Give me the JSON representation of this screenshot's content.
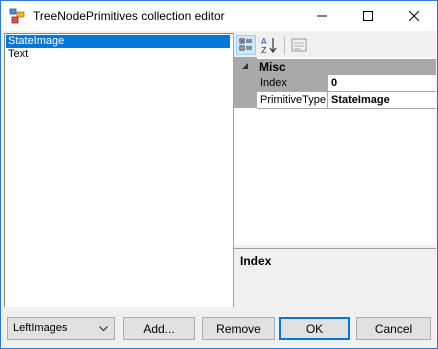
{
  "window": {
    "title": "TreeNodePrimitives collection editor"
  },
  "list": {
    "items": [
      {
        "label": "StateImage",
        "selected": true
      },
      {
        "label": "Text",
        "selected": false
      }
    ]
  },
  "toolbar": {
    "buttons": [
      "categorized-view",
      "alphabetical-sort",
      "property-pages"
    ]
  },
  "property_grid": {
    "category": "Misc",
    "rows": [
      {
        "name": "Index",
        "value": "0"
      },
      {
        "name": "PrimitiveType",
        "value": "StateImage"
      }
    ]
  },
  "help": {
    "title": "Index"
  },
  "bottom": {
    "combo_value": "LeftImages",
    "add_label": "Add...",
    "remove_label": "Remove",
    "ok_label": "OK",
    "cancel_label": "Cancel"
  },
  "colors": {
    "selection": "#0078d7",
    "grid_category": "#aaa9aa",
    "window_border": "#2b79d7"
  }
}
